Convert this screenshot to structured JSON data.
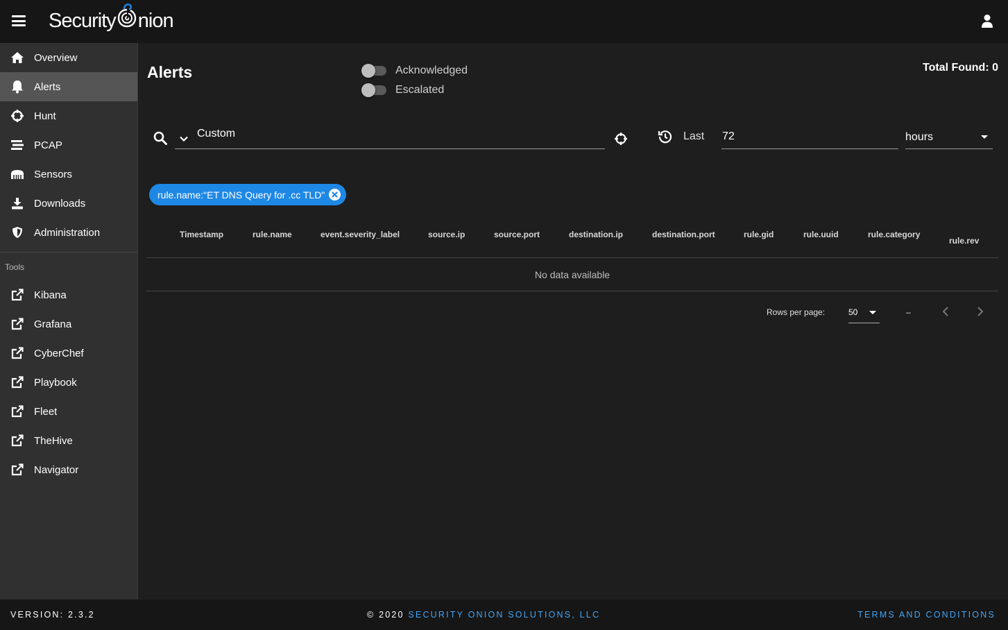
{
  "app": {
    "logo_text_left": "Security",
    "logo_text_right": "nion"
  },
  "sidebar": {
    "items": [
      {
        "label": "Overview",
        "icon": "home-icon"
      },
      {
        "label": "Alerts",
        "icon": "bell-icon",
        "active": true
      },
      {
        "label": "Hunt",
        "icon": "crosshairs-icon"
      },
      {
        "label": "PCAP",
        "icon": "stream-icon"
      },
      {
        "label": "Sensors",
        "icon": "network-wired-icon"
      },
      {
        "label": "Downloads",
        "icon": "download-icon"
      },
      {
        "label": "Administration",
        "icon": "shield-icon"
      }
    ],
    "tools_header": "Tools",
    "tools": [
      {
        "label": "Kibana",
        "icon": "external-link-icon"
      },
      {
        "label": "Grafana",
        "icon": "external-link-icon"
      },
      {
        "label": "CyberChef",
        "icon": "external-link-icon"
      },
      {
        "label": "Playbook",
        "icon": "external-link-icon"
      },
      {
        "label": "Fleet",
        "icon": "external-link-icon"
      },
      {
        "label": "TheHive",
        "icon": "external-link-icon"
      },
      {
        "label": "Navigator",
        "icon": "external-link-icon"
      }
    ]
  },
  "main": {
    "title": "Alerts",
    "toggles": {
      "acknowledged": {
        "label": "Acknowledged",
        "on": false
      },
      "escalated": {
        "label": "Escalated",
        "on": false
      }
    },
    "total_found": "Total Found: 0",
    "query": {
      "value": "Custom"
    },
    "time": {
      "prefix": "Last",
      "amount": "72",
      "unit": "hours"
    },
    "filter_chip": "rule.name:\"ET DNS Query for .cc TLD\"",
    "table": {
      "columns": [
        "Timestamp",
        "rule.name",
        "event.severity_label",
        "source.ip",
        "source.port",
        "destination.ip",
        "destination.port",
        "rule.gid",
        "rule.uuid",
        "rule.category",
        "rule.rev"
      ],
      "empty_text": "No data available",
      "rows_per_page_label": "Rows per page:",
      "rows_per_page": "50",
      "page_range": "–"
    }
  },
  "footer": {
    "version": "VERSION: 2.3.2",
    "copyright_prefix": "© 2020 ",
    "copyright_link": "SECURITY ONION SOLUTIONS, LLC",
    "terms": "TERMS AND CONDITIONS"
  },
  "colors": {
    "accent": "#1e88e5",
    "link": "#42a5f5",
    "sidebar_bg": "#303030",
    "active_bg": "#555555",
    "appbar_bg": "#161616"
  }
}
